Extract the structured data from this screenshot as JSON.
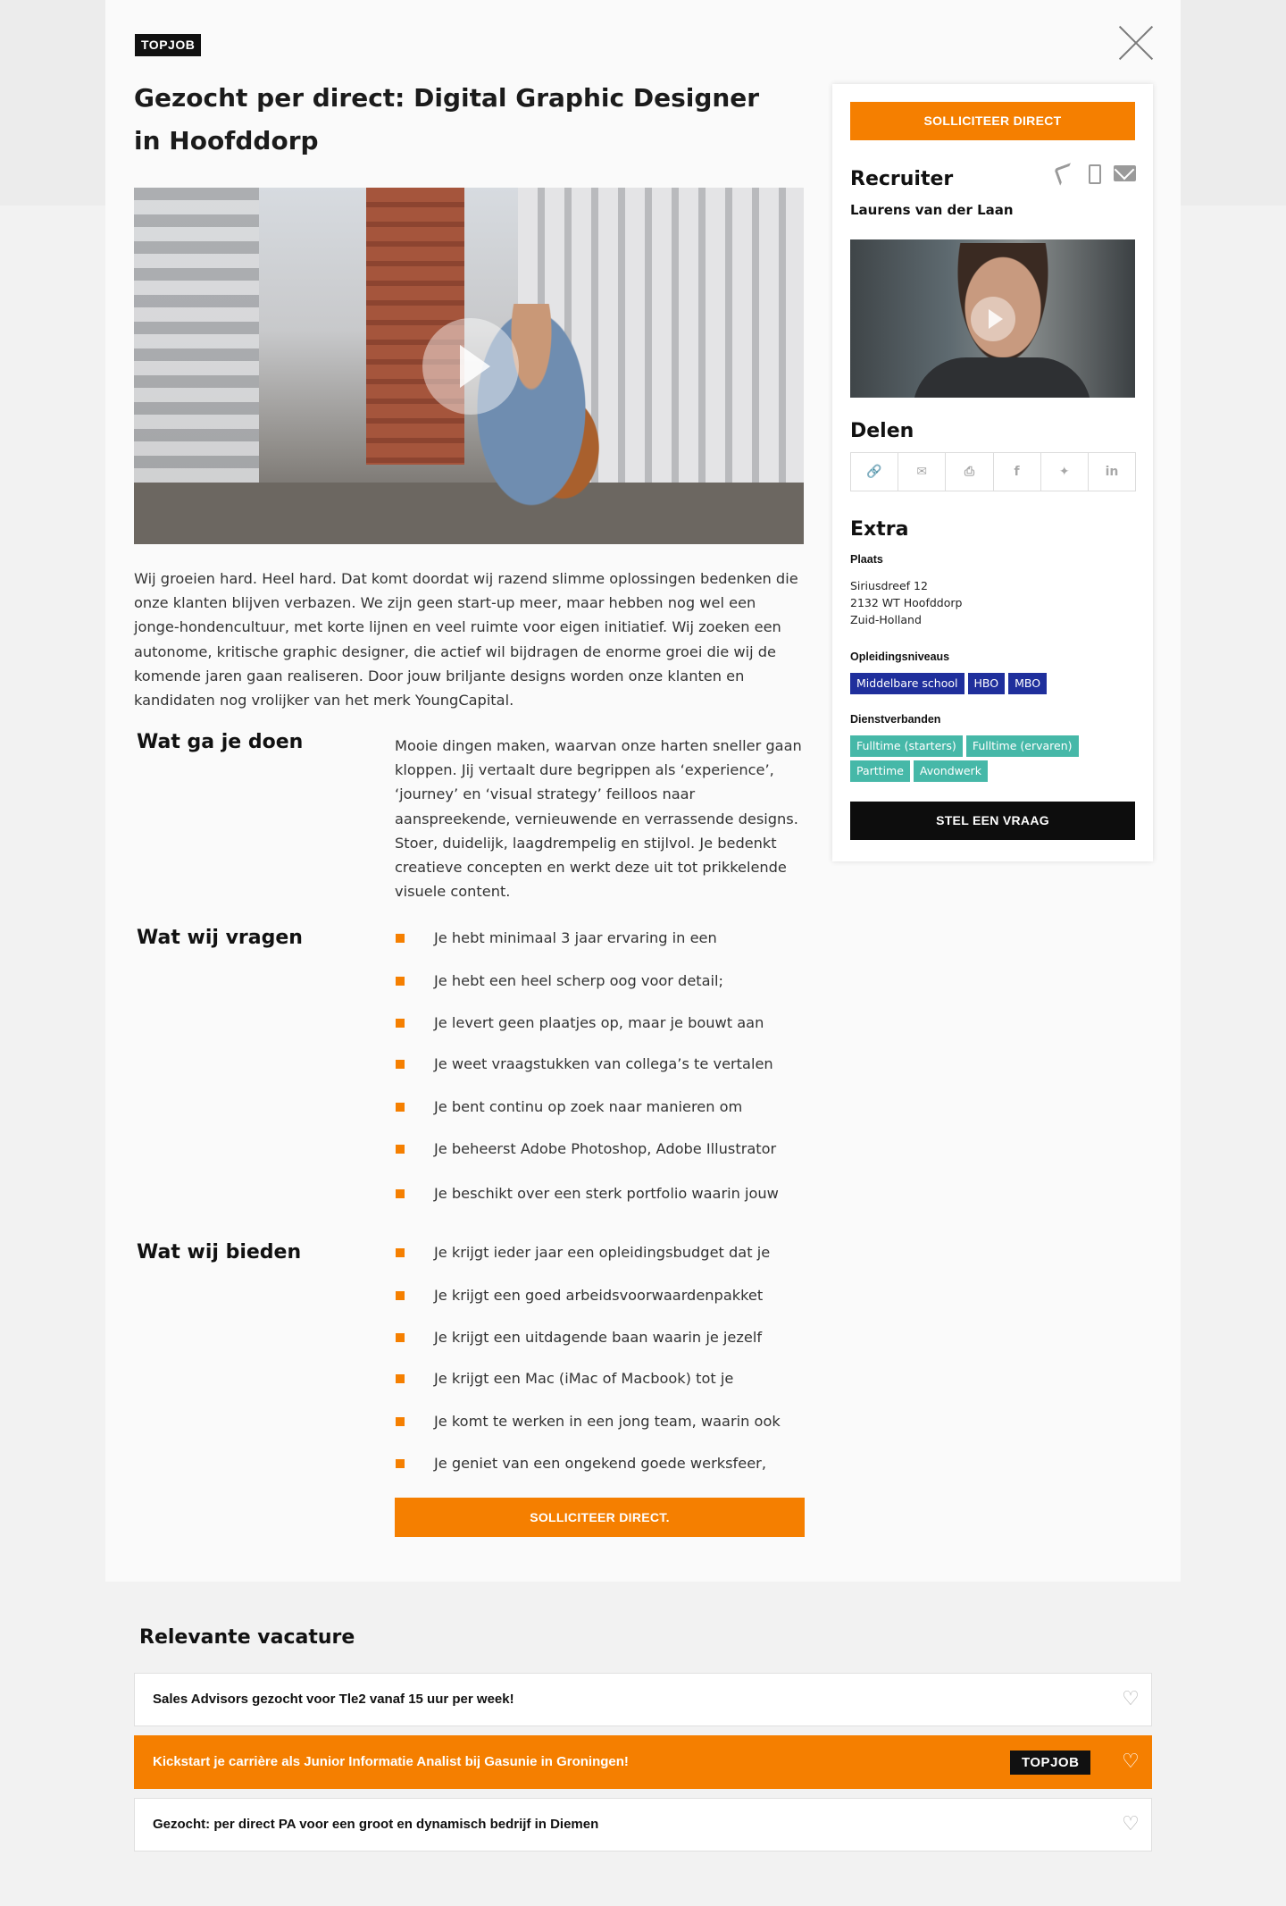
{
  "badge": "TOPJOB",
  "job": {
    "title": "Gezocht per direct: Digital Graphic Designer in Hoofddorp",
    "intro": "Wij groeien hard. Heel hard. Dat komt doordat wij razend slimme oplossingen bedenken die onze klanten blijven verbazen. We zijn geen start-up meer, maar hebben nog wel een jonge-hondencultuur, met korte lijnen en veel ruimte voor eigen initiatief. Wij zoeken een autonome, kritische graphic designer, die actief wil bijdragen de enorme groei die wij de komende jaren gaan realiseren. Door jouw briljante designs worden onze klanten en kandidaten nog vrolijker van het merk YoungCapital."
  },
  "sections": {
    "doen": {
      "heading": "Wat ga je doen",
      "text": "Mooie dingen maken, waarvan onze harten sneller gaan kloppen. Jij vertaalt dure begrippen als ‘experience’, ‘journey’ en ‘visual strategy’ feilloos naar aanspreekende, vernieuwende en verrassende designs. Stoer, duidelijk, laagdrempelig en stijlvol. Je bedenkt creatieve concepten en werkt deze uit tot prikkelende visuele content."
    },
    "vragen": {
      "heading": "Wat wij vragen",
      "items": [
        "Je hebt minimaal 3 jaar ervaring in een",
        "Je hebt een heel scherp oog voor detail;",
        "Je levert geen plaatjes op, maar je bouwt aan",
        "Je weet vraagstukken van collega’s te vertalen",
        "Je bent continu op zoek naar manieren om",
        "Je beheerst Adobe Photoshop, Adobe Illustrator",
        "Je beschikt over een sterk portfolio waarin jouw"
      ]
    },
    "bieden": {
      "heading": "Wat wij bieden",
      "items": [
        "Je krijgt ieder jaar een opleidingsbudget dat je",
        "Je krijgt een goed arbeidsvoorwaardenpakket",
        "Je krijgt een uitdagende baan waarin je jezelf",
        "Je krijgt een Mac (iMac of Macbook) tot je",
        "Je komt te werken in een jong team, waarin ook",
        "Je geniet van een ongekend goede werksfeer,"
      ]
    },
    "apply_bottom": "SOLLICITEER DIRECT."
  },
  "sidebar": {
    "apply_label": "SOLLICITEER DIRECT",
    "recruiter_heading": "Recruiter",
    "recruiter_name": "Laurens van der Laan",
    "share_heading": "Delen",
    "extra_heading": "Extra",
    "plaats_label": "Plaats",
    "address": [
      "Siriusdreef 12",
      "2132 WT Hoofddorp",
      "Zuid-Holland"
    ],
    "opleiding_label": "Opleidingsniveaus",
    "opleiding_tags": [
      "Middelbare school",
      "HBO",
      "MBO"
    ],
    "dienst_label": "Dienstverbanden",
    "dienst_tags": [
      "Fulltime (starters)",
      "Fulltime (ervaren)",
      "Parttime",
      "Avondwerk"
    ],
    "ask_label": "STEL EEN VRAAG"
  },
  "related": {
    "title": "Relevante vacature",
    "items": [
      {
        "text": "Sales Advisors gezocht voor Tle2 vanaf 15 uur per week!",
        "badge": ""
      },
      {
        "text": "Kickstart je carrière als Junior Informatie Analist bij Gasunie in Groningen!",
        "badge": "TOPJOB"
      },
      {
        "text": "Gezocht: per direct PA voor een groot en dynamisch bedrijf in Diemen",
        "badge": ""
      }
    ]
  },
  "icons": {
    "share": [
      "link-icon",
      "mail-icon",
      "print-icon",
      "facebook-icon",
      "twitter-icon",
      "linkedin-icon"
    ],
    "contact": [
      "phone-icon",
      "mobile-icon",
      "mail-icon"
    ],
    "close": "close-icon",
    "favorite": "heart-icon"
  },
  "colors": {
    "accent": "#f57f00",
    "education_tag": "#1f2f9c",
    "employment_tag": "#46b8a8",
    "badge": "#111111"
  }
}
